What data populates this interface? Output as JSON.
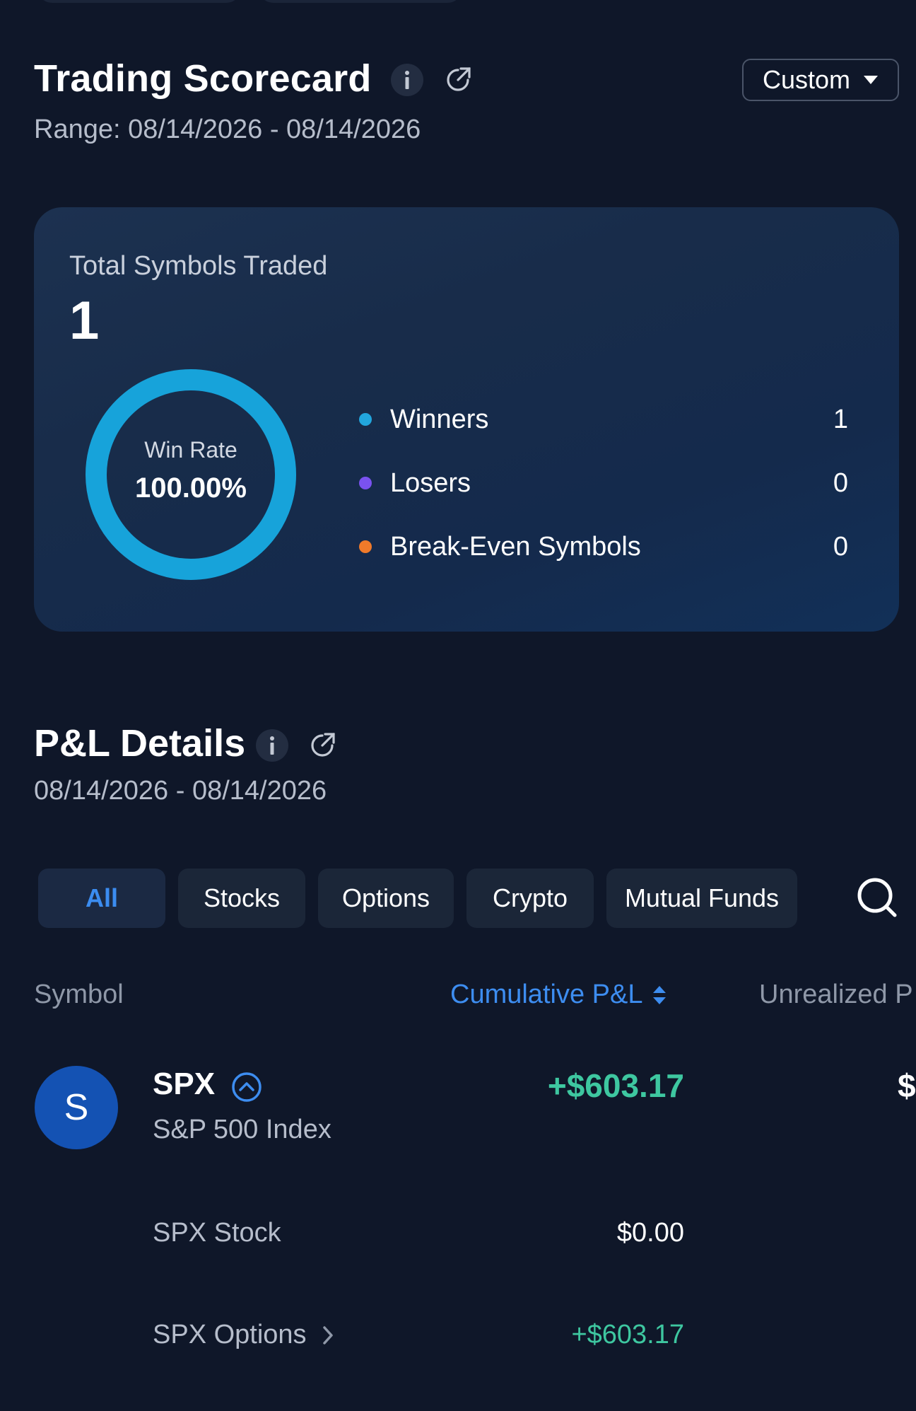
{
  "scorecard": {
    "title": "Trading Scorecard",
    "range": "Range: 08/14/2026 - 08/14/2026",
    "period_button": "Custom",
    "total_label": "Total Symbols Traded",
    "total_value": "1",
    "win_rate_label": "Win Rate",
    "win_rate_value": "100.00%",
    "win_rate_fraction": 1.0,
    "legend": [
      {
        "label": "Winners",
        "value": "1",
        "color": "#22a6dd"
      },
      {
        "label": "Losers",
        "value": "0",
        "color": "#7a52f0"
      },
      {
        "label": "Break-Even Symbols",
        "value": "0",
        "color": "#f07a2a"
      }
    ]
  },
  "pl": {
    "title": "P&L Details",
    "range": "08/14/2026 - 08/14/2026",
    "filters": [
      "All",
      "Stocks",
      "Options",
      "Crypto",
      "Mutual Funds"
    ],
    "active_filter": "All",
    "columns": {
      "symbol": "Symbol",
      "cumulative": "Cumulative P&L",
      "unrealized": "Unrealized P"
    },
    "row": {
      "avatar_letter": "S",
      "symbol": "SPX",
      "name": "S&P 500 Index",
      "cumulative": "+$603.17",
      "unrealized_clip": "$",
      "sub_rows": [
        {
          "label": "SPX Stock",
          "value": "$0.00"
        },
        {
          "label": "SPX Options",
          "value": "+$603.17"
        }
      ]
    }
  },
  "colors": {
    "background": "#0f1729",
    "accent_blue": "#3d8df0",
    "positive_green": "#3ec7a0",
    "donut_ring": "#17a3da"
  }
}
